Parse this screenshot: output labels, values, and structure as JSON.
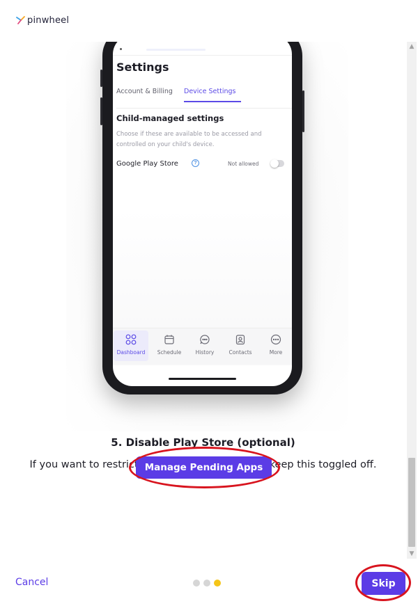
{
  "brand": {
    "name": "pinwheel"
  },
  "phone": {
    "screen_title": "Settings",
    "tabs": [
      {
        "label": "Account & Billing",
        "active": false
      },
      {
        "label": "Device Settings",
        "active": true
      }
    ],
    "section_title": "Child-managed settings",
    "section_desc": "Choose if these are available to be accessed and controlled on your child's device.",
    "setting": {
      "label": "Google Play Store",
      "status": "Not allowed",
      "enabled": false
    },
    "nav": [
      {
        "label": "Dashboard",
        "icon": "grid-icon",
        "active": true
      },
      {
        "label": "Schedule",
        "icon": "calendar-icon",
        "active": false
      },
      {
        "label": "History",
        "icon": "chat-icon",
        "active": false
      },
      {
        "label": "Contacts",
        "icon": "contact-icon",
        "active": false
      },
      {
        "label": "More",
        "icon": "more-icon",
        "active": false
      }
    ]
  },
  "step": {
    "title": "5. Disable Play Store (optional)",
    "text": "If you want to restrict access to the Play Store, keep this toggled off."
  },
  "actions": {
    "manage_label": "Manage Pending Apps",
    "cancel_label": "Cancel",
    "skip_label": "Skip"
  },
  "pagination": {
    "total": 3,
    "current": 3
  },
  "colors": {
    "accent": "#5b3ce6",
    "active_dot": "#f5c518",
    "annotation": "#d8141e"
  }
}
